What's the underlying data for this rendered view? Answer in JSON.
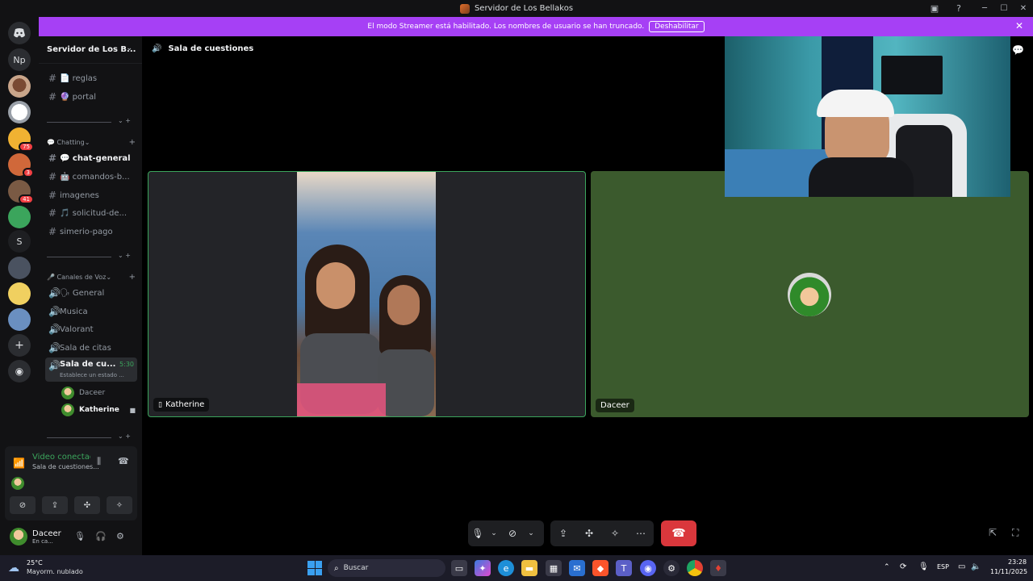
{
  "window": {
    "title": "Servidor de Los Bellakos"
  },
  "banner": {
    "text": "El modo Streamer está habilitado. Los nombres de usuario se han truncado.",
    "button": "Deshabilitar"
  },
  "guilds": {
    "np_label": "Np",
    "s_label": "S",
    "badges": [
      "75",
      "3",
      "41"
    ]
  },
  "server": {
    "name": "Servidor de Los B..."
  },
  "channels": {
    "top": [
      {
        "name": "📄 reglas"
      },
      {
        "name": "🔮 portal"
      }
    ],
    "chatting_category": "💬 Chatting",
    "chatting": [
      {
        "name": "💬 chat-general"
      },
      {
        "name": "🤖 comandos-b..."
      },
      {
        "name": "imagenes"
      },
      {
        "name": "🎵 solicitud-de..."
      },
      {
        "name": "simerio-pago"
      }
    ],
    "voice_category": "🎤 Canales de Voz",
    "voice": [
      {
        "name": "🗣 General"
      },
      {
        "name": "Musica"
      },
      {
        "name": "Valorant"
      },
      {
        "name": "Sala de citas"
      },
      {
        "name": "Sala de cu...",
        "time": "5:30",
        "status": "Establece un estado ..."
      }
    ],
    "voice_users": [
      {
        "name": "Daceer"
      },
      {
        "name": "Katherine"
      }
    ]
  },
  "status_panel": {
    "title": "Video conectad",
    "subtitle": "Sala de cuestiones..."
  },
  "user": {
    "name": "Daceer",
    "status": "En ca..."
  },
  "voice_channel": {
    "title": "Sala de cuestiones"
  },
  "tiles": [
    {
      "name": "Katherine"
    },
    {
      "name": "Daceer"
    }
  ],
  "taskbar": {
    "weather_temp": "25°C",
    "weather_desc": "Mayorm. nublado",
    "search_placeholder": "Buscar",
    "lang": "ESP",
    "time": "23:28",
    "date": "11/11/2025"
  },
  "colors": {
    "accent": "#a640f5",
    "online": "#3ba55c",
    "danger": "#da373c"
  }
}
